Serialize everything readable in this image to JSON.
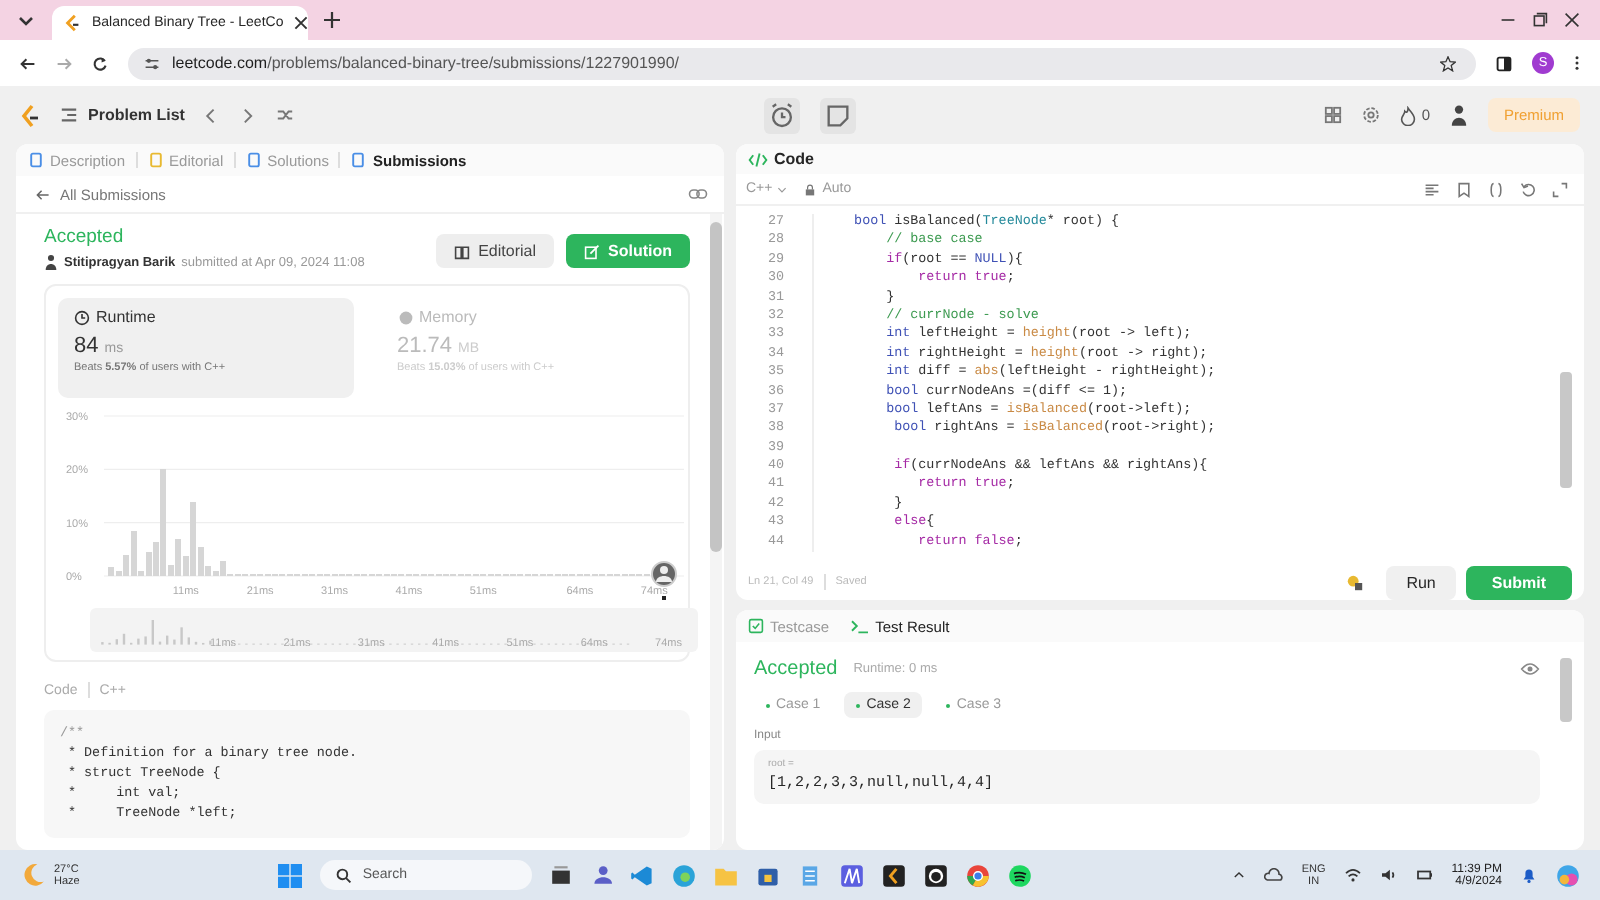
{
  "browser": {
    "tab_title": "Balanced Binary Tree - LeetCo",
    "url_host": "leetcode.com",
    "url_path": "/problems/balanced-binary-tree/submissions/1227901990/",
    "profile_initial": "S"
  },
  "nav": {
    "problem_list": "Problem List",
    "streak": "0",
    "premium": "Premium"
  },
  "left_tabs": [
    {
      "label": "Description",
      "selected": false,
      "kind": "description"
    },
    {
      "label": "Editorial",
      "selected": false,
      "kind": "editorial"
    },
    {
      "label": "Solutions",
      "selected": false,
      "kind": "solutions"
    },
    {
      "label": "Submissions",
      "selected": true,
      "kind": "submissions"
    }
  ],
  "back_link": "All Submissions",
  "submission": {
    "status": "Accepted",
    "user": "Stitipragyan Barik",
    "submitted": "submitted at Apr 09, 2024 11:08",
    "buttons": [
      {
        "label": "Editorial",
        "kind": "secondary"
      },
      {
        "label": "Solution",
        "kind": "primary"
      }
    ]
  },
  "metrics": [
    {
      "kind": "runtime",
      "label": "Runtime",
      "value": "84",
      "unit": "ms",
      "beats": "Beats **5.57%** of users with C++",
      "selected": true
    },
    {
      "kind": "memory",
      "label": "Memory",
      "value": "21.74",
      "unit": "MB",
      "beats": "Beats **15.03%** of users with C++",
      "selected": false
    }
  ],
  "chart_data": {
    "type": "bar",
    "x": [
      1,
      2,
      3,
      4,
      5,
      6,
      7,
      8,
      9,
      10,
      11,
      12,
      13,
      14,
      15,
      16,
      17,
      18,
      19,
      20,
      21,
      22,
      23,
      24,
      25,
      26,
      27,
      28,
      29,
      30,
      31,
      32,
      33,
      34,
      35,
      36,
      37,
      38,
      39,
      40,
      41,
      42,
      43,
      44,
      45,
      46,
      47,
      48,
      49,
      50,
      51,
      52,
      53,
      54,
      55,
      56,
      57,
      58,
      59,
      60,
      61,
      62,
      63,
      64,
      65,
      66,
      67,
      68,
      69,
      70,
      71,
      72,
      73,
      74
    ],
    "values": [
      1.6,
      1,
      4,
      8.5,
      1,
      4.5,
      6.3,
      20,
      2,
      7,
      3.7,
      13.9,
      5.5,
      1.8,
      0.9,
      2.8,
      0.3,
      0.3,
      0.3,
      0.3,
      0.3,
      0.3,
      0.3,
      0.3,
      0.3,
      0.3,
      0.3,
      0.3,
      0.3,
      0.3,
      0.3,
      0.3,
      0.3,
      0.3,
      0.3,
      0.3,
      0.3,
      0.3,
      0.3,
      0.3,
      0.3,
      0.3,
      0.3,
      0.3,
      0.3,
      0.3,
      0.3,
      0.3,
      0.3,
      0.3,
      0.3,
      0.3,
      0.3,
      0.3,
      0.3,
      0.3,
      0.3,
      0.3,
      0.3,
      0.3,
      0.3,
      0.3,
      0.3,
      0.3,
      0.3,
      0.3,
      0.3,
      0.3,
      0.3,
      0.3,
      0.3,
      0.3,
      0.3,
      0.3
    ],
    "xlim": [
      0,
      78
    ],
    "ylim": [
      0,
      30
    ],
    "xticks": [
      {
        "value": 11,
        "label": "11ms"
      },
      {
        "value": 21,
        "label": "21ms"
      },
      {
        "value": 31,
        "label": "31ms"
      },
      {
        "value": 41,
        "label": "41ms"
      },
      {
        "value": 51,
        "label": "51ms"
      },
      {
        "value": 64,
        "label": "64ms"
      },
      {
        "value": 74,
        "label": "74ms"
      }
    ],
    "yticks": [
      {
        "value": 0,
        "label": "0%"
      },
      {
        "value": 10,
        "label": "10%"
      },
      {
        "value": 20,
        "label": "20%"
      },
      {
        "value": 30,
        "label": "30%"
      }
    ]
  },
  "range_labels": [
    "11ms",
    "21ms",
    "31ms",
    "41ms",
    "51ms",
    "64ms",
    "74ms"
  ],
  "code_view": {
    "label": "Code",
    "language": "C++",
    "lines": [
      "/**",
      " * Definition for a binary tree node.",
      " * struct TreeNode {",
      " *     int val;",
      " *     TreeNode *left;"
    ]
  },
  "editor": {
    "title": "Code",
    "language": "C++",
    "mode": "Auto",
    "cursor": "Ln 21, Col 49",
    "save_state": "Saved",
    "run": "Run",
    "submit": "Submit",
    "lines": [
      {
        "number": "27",
        "tokens": [
          {
            "kind": "kw",
            "text": "    bool"
          },
          {
            "kind": "plain",
            "text": " isBalanced("
          },
          {
            "kind": "type",
            "text": "TreeNode"
          },
          {
            "kind": "plain",
            "text": "* root) {"
          }
        ]
      },
      {
        "number": "28",
        "tokens": [
          {
            "kind": "comment",
            "text": "        // base case"
          }
        ]
      },
      {
        "number": "29",
        "tokens": [
          {
            "kind": "ctrl",
            "text": "        if"
          },
          {
            "kind": "plain",
            "text": "(root == "
          },
          {
            "kind": "kw",
            "text": "NULL"
          },
          {
            "kind": "plain",
            "text": "){"
          }
        ]
      },
      {
        "number": "30",
        "tokens": [
          {
            "kind": "ctrl",
            "text": "            return true"
          },
          {
            "kind": "plain",
            "text": ";"
          }
        ]
      },
      {
        "number": "31",
        "tokens": [
          {
            "kind": "plain",
            "text": "        }"
          }
        ]
      },
      {
        "number": "32",
        "tokens": [
          {
            "kind": "comment",
            "text": "        // currNode - solve"
          }
        ]
      },
      {
        "number": "33",
        "tokens": [
          {
            "kind": "kw",
            "text": "        int"
          },
          {
            "kind": "plain",
            "text": " leftHeight = "
          },
          {
            "kind": "func",
            "text": "height"
          },
          {
            "kind": "plain",
            "text": "(root -> left);"
          }
        ]
      },
      {
        "number": "34",
        "tokens": [
          {
            "kind": "kw",
            "text": "        int"
          },
          {
            "kind": "plain",
            "text": " rightHeight = "
          },
          {
            "kind": "func",
            "text": "height"
          },
          {
            "kind": "plain",
            "text": "(root -> right);"
          }
        ]
      },
      {
        "number": "35",
        "tokens": [
          {
            "kind": "kw",
            "text": "        int"
          },
          {
            "kind": "plain",
            "text": " diff = "
          },
          {
            "kind": "func",
            "text": "abs"
          },
          {
            "kind": "plain",
            "text": "(leftHeight - rightHeight);"
          }
        ]
      },
      {
        "number": "36",
        "tokens": [
          {
            "kind": "kw",
            "text": "        bool"
          },
          {
            "kind": "plain",
            "text": " currNodeAns =(diff <= 1);"
          }
        ]
      },
      {
        "number": "37",
        "tokens": [
          {
            "kind": "kw",
            "text": "        bool"
          },
          {
            "kind": "plain",
            "text": " leftAns = "
          },
          {
            "kind": "func",
            "text": "isBalanced"
          },
          {
            "kind": "plain",
            "text": "(root->left);"
          }
        ]
      },
      {
        "number": "38",
        "tokens": [
          {
            "kind": "kw",
            "text": "         bool"
          },
          {
            "kind": "plain",
            "text": " rightAns = "
          },
          {
            "kind": "func",
            "text": "isBalanced"
          },
          {
            "kind": "plain",
            "text": "(root->right);"
          }
        ]
      },
      {
        "number": "39"
      },
      {
        "number": "40",
        "tokens": [
          {
            "kind": "ctrl",
            "text": "         if"
          },
          {
            "kind": "plain",
            "text": "(currNodeAns && leftAns && rightAns){"
          }
        ]
      },
      {
        "number": "41",
        "tokens": [
          {
            "kind": "ctrl",
            "text": "            return true"
          },
          {
            "kind": "plain",
            "text": ";"
          }
        ]
      },
      {
        "number": "42",
        "tokens": [
          {
            "kind": "plain",
            "text": "         }"
          }
        ]
      },
      {
        "number": "43",
        "tokens": [
          {
            "kind": "ctrl",
            "text": "         else"
          },
          {
            "kind": "plain",
            "text": "{"
          }
        ]
      },
      {
        "number": "44",
        "tokens": [
          {
            "kind": "ctrl",
            "text": "            return false"
          },
          {
            "kind": "plain",
            "text": ";"
          }
        ]
      }
    ]
  },
  "result_tabs": [
    {
      "label": "Testcase",
      "selected": false,
      "kind": "testcase"
    },
    {
      "label": "Test Result",
      "selected": true,
      "kind": "result"
    }
  ],
  "result": {
    "status": "Accepted",
    "runtime": "Runtime: 0 ms",
    "cases": [
      {
        "label": "Case 1",
        "selected": false
      },
      {
        "label": "Case 2",
        "selected": true
      },
      {
        "label": "Case 3",
        "selected": false
      }
    ],
    "input_label": "Input",
    "param": "root =",
    "value": "[1,2,2,3,3,null,null,4,4]"
  },
  "taskbar": {
    "temperature": "27°C",
    "weather": "Haze",
    "search_placeholder": "Search",
    "language": "ENG",
    "region": "IN",
    "time": "11:39 PM",
    "date": "4/9/2024"
  }
}
